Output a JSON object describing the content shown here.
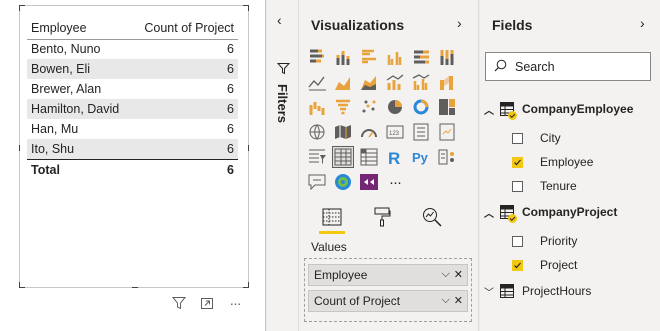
{
  "table_visual": {
    "columns": [
      "Employee",
      "Count of Project"
    ],
    "rows": [
      [
        "Bento, Nuno",
        "6"
      ],
      [
        "Bowen, Eli",
        "6"
      ],
      [
        "Brewer, Alan",
        "6"
      ],
      [
        "Hamilton, David",
        "6"
      ],
      [
        "Han, Mu",
        "6"
      ],
      [
        "Ito, Shu",
        "6"
      ]
    ],
    "total": [
      "Total",
      "6"
    ],
    "toolbar_icons": [
      "filter-icon",
      "focus-mode-icon",
      "more-options-icon"
    ],
    "more_label": "···"
  },
  "filters_pane": {
    "label": "Filters",
    "collapse_glyph": "‹"
  },
  "visualizations_pane": {
    "title": "Visualizations",
    "expand_glyph": "›",
    "visual_icons": [
      "stacked-bar-chart-icon",
      "stacked-column-chart-icon",
      "clustered-bar-chart-icon",
      "clustered-column-chart-icon",
      "100-stacked-bar-chart-icon",
      "100-stacked-column-chart-icon",
      "line-chart-icon",
      "area-chart-icon",
      "stacked-area-chart-icon",
      "line-and-stacked-column-chart-icon",
      "line-and-clustered-column-chart-icon",
      "ribbon-chart-icon",
      "waterfall-chart-icon",
      "funnel-chart-icon",
      "scatter-chart-icon",
      "pie-chart-icon",
      "donut-chart-icon",
      "treemap-icon",
      "map-icon",
      "filled-map-icon",
      "gauge-icon",
      "card-icon",
      "multi-row-card-icon",
      "kpi-icon",
      "slicer-icon",
      "table-icon",
      "matrix-icon",
      "r-script-visual-icon",
      "python-visual-icon",
      "key-influencers-icon",
      "qa-visual-icon",
      "arcgis-map-icon",
      "power-apps-icon",
      "more-visuals-icon"
    ],
    "selected_visual_index": 25,
    "more_visuals_label": "···",
    "tabs": [
      "fields-tab-icon",
      "format-tab-icon",
      "analytics-tab-icon"
    ],
    "active_tab_index": 0,
    "values_label": "Values",
    "wells": [
      "Employee",
      "Count of Project"
    ],
    "well_controls": {
      "expand": "⌵",
      "remove": "✕"
    }
  },
  "fields_pane": {
    "title": "Fields",
    "expand_glyph": "›",
    "search_placeholder": "Search",
    "tables": [
      {
        "name": "CompanyEmployee",
        "expanded": true,
        "has_selection": true,
        "fields": [
          {
            "name": "City",
            "checked": false
          },
          {
            "name": "Employee",
            "checked": true
          },
          {
            "name": "Tenure",
            "checked": false
          }
        ]
      },
      {
        "name": "CompanyProject",
        "expanded": true,
        "has_selection": true,
        "fields": [
          {
            "name": "Priority",
            "checked": false
          },
          {
            "name": "Project",
            "checked": true
          }
        ]
      },
      {
        "name": "ProjectHours",
        "expanded": false,
        "has_selection": false,
        "fields": []
      }
    ],
    "colors": {
      "accent": "#f2c811"
    }
  }
}
